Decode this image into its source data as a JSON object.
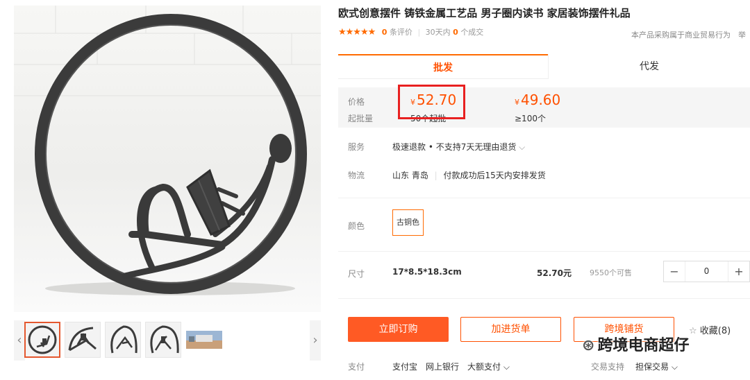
{
  "product": {
    "title": "欧式创意摆件 铸铁金属工艺品 男子圈内读书 家居装饰摆件礼品",
    "stars": "★★★★★",
    "review_count": "0",
    "review_suffix": "条评价",
    "deals_prefix": "30天内",
    "deals_count": "0",
    "deals_suffix": "个成交",
    "trade_note": "本产品采购属于商业贸易行为　举"
  },
  "tabs": [
    {
      "label": "批发"
    },
    {
      "label": "代发"
    }
  ],
  "pricing": {
    "price_label": "价格",
    "moq_label": "起批量",
    "currency": "¥",
    "tier1_price": "52.70",
    "tier1_moq": "50个起批",
    "tier2_price": "49.60",
    "tier2_moq": "≥100个"
  },
  "service": {
    "label": "服务",
    "value": "极速退款 • 不支持7天无理由退货",
    "chevron": "⌵"
  },
  "logistics": {
    "label": "物流",
    "origin": "山东 青岛",
    "ship_note": "付款成功后15天内安排发货"
  },
  "color": {
    "label": "颜色",
    "option": "古铜色"
  },
  "size": {
    "label": "尺寸",
    "name": "17*8.5*18.3cm",
    "price": "52.70元",
    "stock": "9550个可售",
    "quantity": "0",
    "minus": "−",
    "plus": "+"
  },
  "actions": {
    "buy": "立即订购",
    "cart": "加进货单",
    "cross_border": "跨境铺货",
    "favorite": "收藏(8)",
    "favorite_star": "☆"
  },
  "payment": {
    "label": "支付",
    "methods": [
      "支付宝",
      "网上银行",
      "大额支付 ⌵"
    ],
    "trade_label": "交易支持",
    "trade_value": "担保交易 ⌵"
  },
  "watermark": {
    "icon": "⊛",
    "text": "跨境电商超仔"
  },
  "gallery": {
    "prev": "‹",
    "next": "›"
  }
}
